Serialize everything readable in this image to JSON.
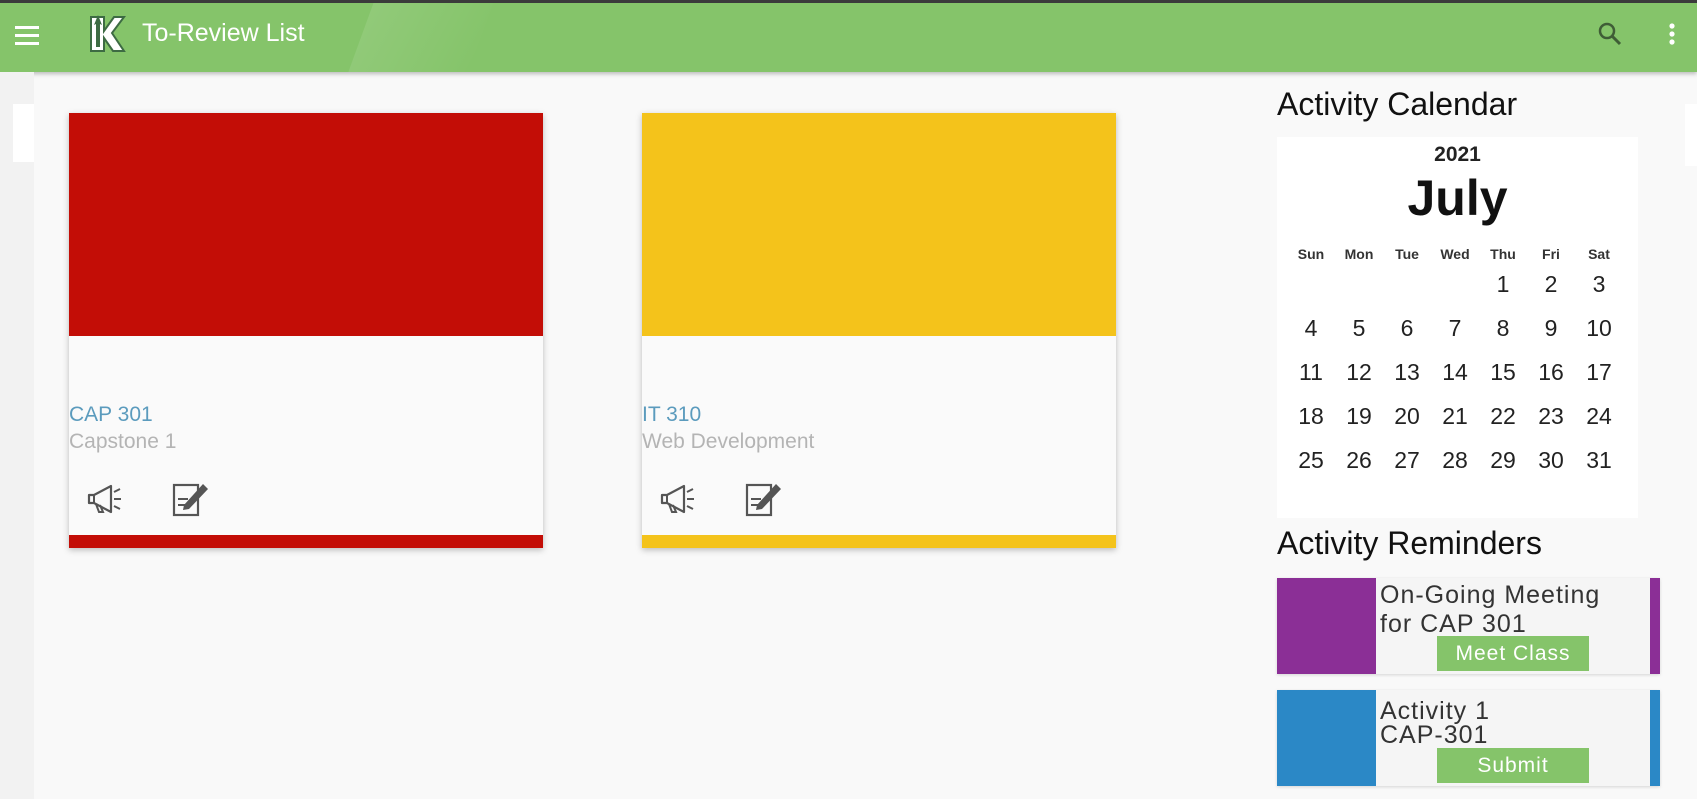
{
  "topbar": {
    "title": "To-Review List",
    "menu_icon": "hamburger-menu-icon",
    "logo": "app-logo-k",
    "search_icon": "search-icon",
    "more_icon": "more-vertical-icon",
    "color": "#85c46a"
  },
  "courses": [
    {
      "code": "CAP 301",
      "name": "Capstone 1",
      "color": "#c30d06",
      "icons": [
        "announcement-icon",
        "edit-document-icon"
      ]
    },
    {
      "code": "IT 310",
      "name": "Web Development",
      "color": "#f4c31b",
      "icons": [
        "announcement-icon",
        "edit-document-icon"
      ]
    }
  ],
  "calendar": {
    "section_title": "Activity Calendar",
    "year": "2021",
    "month": "July",
    "weekdays": [
      "Sun",
      "Mon",
      "Tue",
      "Wed",
      "Thu",
      "Fri",
      "Sat"
    ],
    "first_weekday_index": 4,
    "days_in_month": 31
  },
  "reminders": {
    "section_title": "Activity Reminders",
    "items": [
      {
        "title_line1": "On-Going Meeting",
        "title_line2": "for CAP 301",
        "action_label": "Meet Class",
        "color": "#8b2f96"
      },
      {
        "title_line1": "Activity 1",
        "title_line2": "CAP-301",
        "action_label": "Submit",
        "color": "#2b88c6"
      }
    ]
  }
}
